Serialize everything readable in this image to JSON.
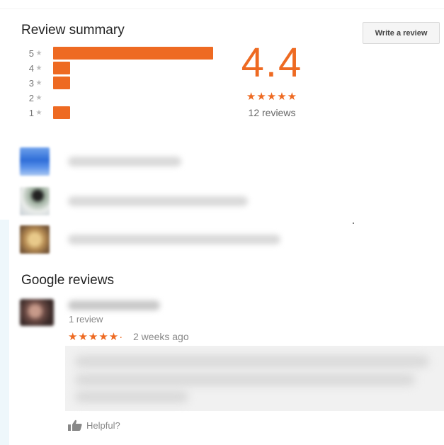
{
  "review_summary": {
    "title": "Review summary",
    "write_review_label": "Write a review",
    "histogram": [
      {
        "stars_label": "5",
        "star_glyph": "★",
        "fraction": 1.0
      },
      {
        "stars_label": "4",
        "star_glyph": "★",
        "fraction": 0.1
      },
      {
        "stars_label": "3",
        "star_glyph": "★",
        "fraction": 0.1
      },
      {
        "stars_label": "2",
        "star_glyph": "★",
        "fraction": 0.0
      },
      {
        "stars_label": "1",
        "star_glyph": "★",
        "fraction": 0.1
      }
    ],
    "average_rating": "4.4",
    "stars_display": "★★★★★",
    "review_count": "12 reviews",
    "accent_color": "#ee6a22"
  },
  "snippets": [
    {
      "avatar_icon": "reviewer-photo-icon",
      "text_state": "blurred"
    },
    {
      "avatar_icon": "reviewer-photo-icon",
      "text_state": "blurred"
    },
    {
      "avatar_icon": "reviewer-photo-icon",
      "text_state": "blurred"
    }
  ],
  "google_reviews": {
    "title": "Google reviews",
    "reviews": [
      {
        "reviewer_meta": "1 review",
        "stars_display": "★★★★★·",
        "date": "2 weeks ago",
        "helpful_label": "Helpful?",
        "helpful_icon": "thumbs-up-icon"
      }
    ]
  }
}
